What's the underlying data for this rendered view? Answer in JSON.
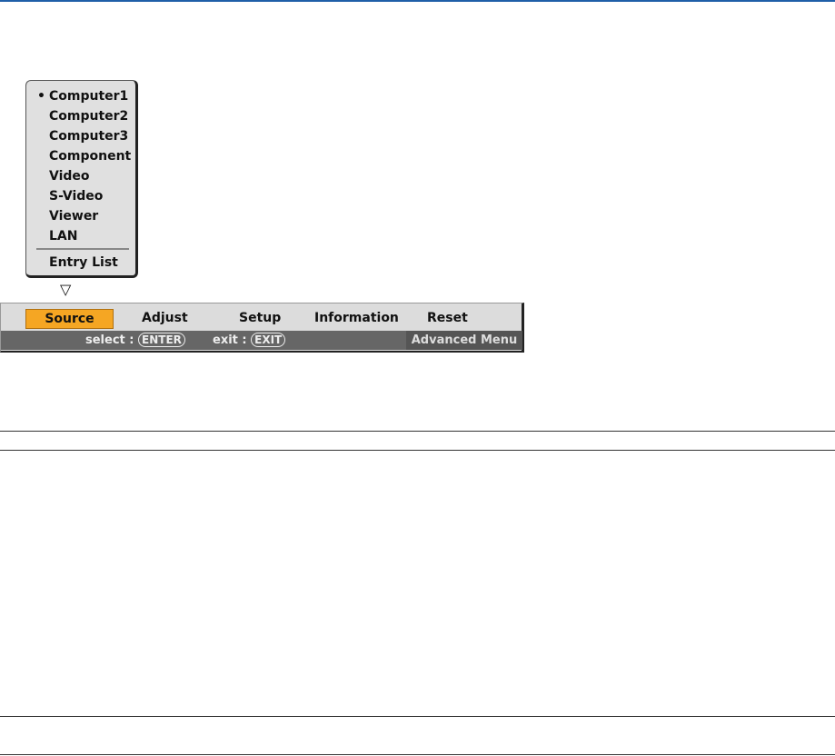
{
  "popup": {
    "items": [
      "Computer1",
      "Computer2",
      "Computer3",
      "Component",
      "Video",
      "S-Video",
      "Viewer",
      "LAN"
    ],
    "entry_list": "Entry List",
    "bullet": "•"
  },
  "menu": {
    "tabs": [
      "Source",
      "Adjust",
      "Setup",
      "Information",
      "Reset"
    ],
    "select_label": "select :",
    "enter_key": "ENTER",
    "exit_label": "exit :",
    "exit_key": "EXIT",
    "advanced": "Advanced Menu",
    "arrow": "▽"
  }
}
